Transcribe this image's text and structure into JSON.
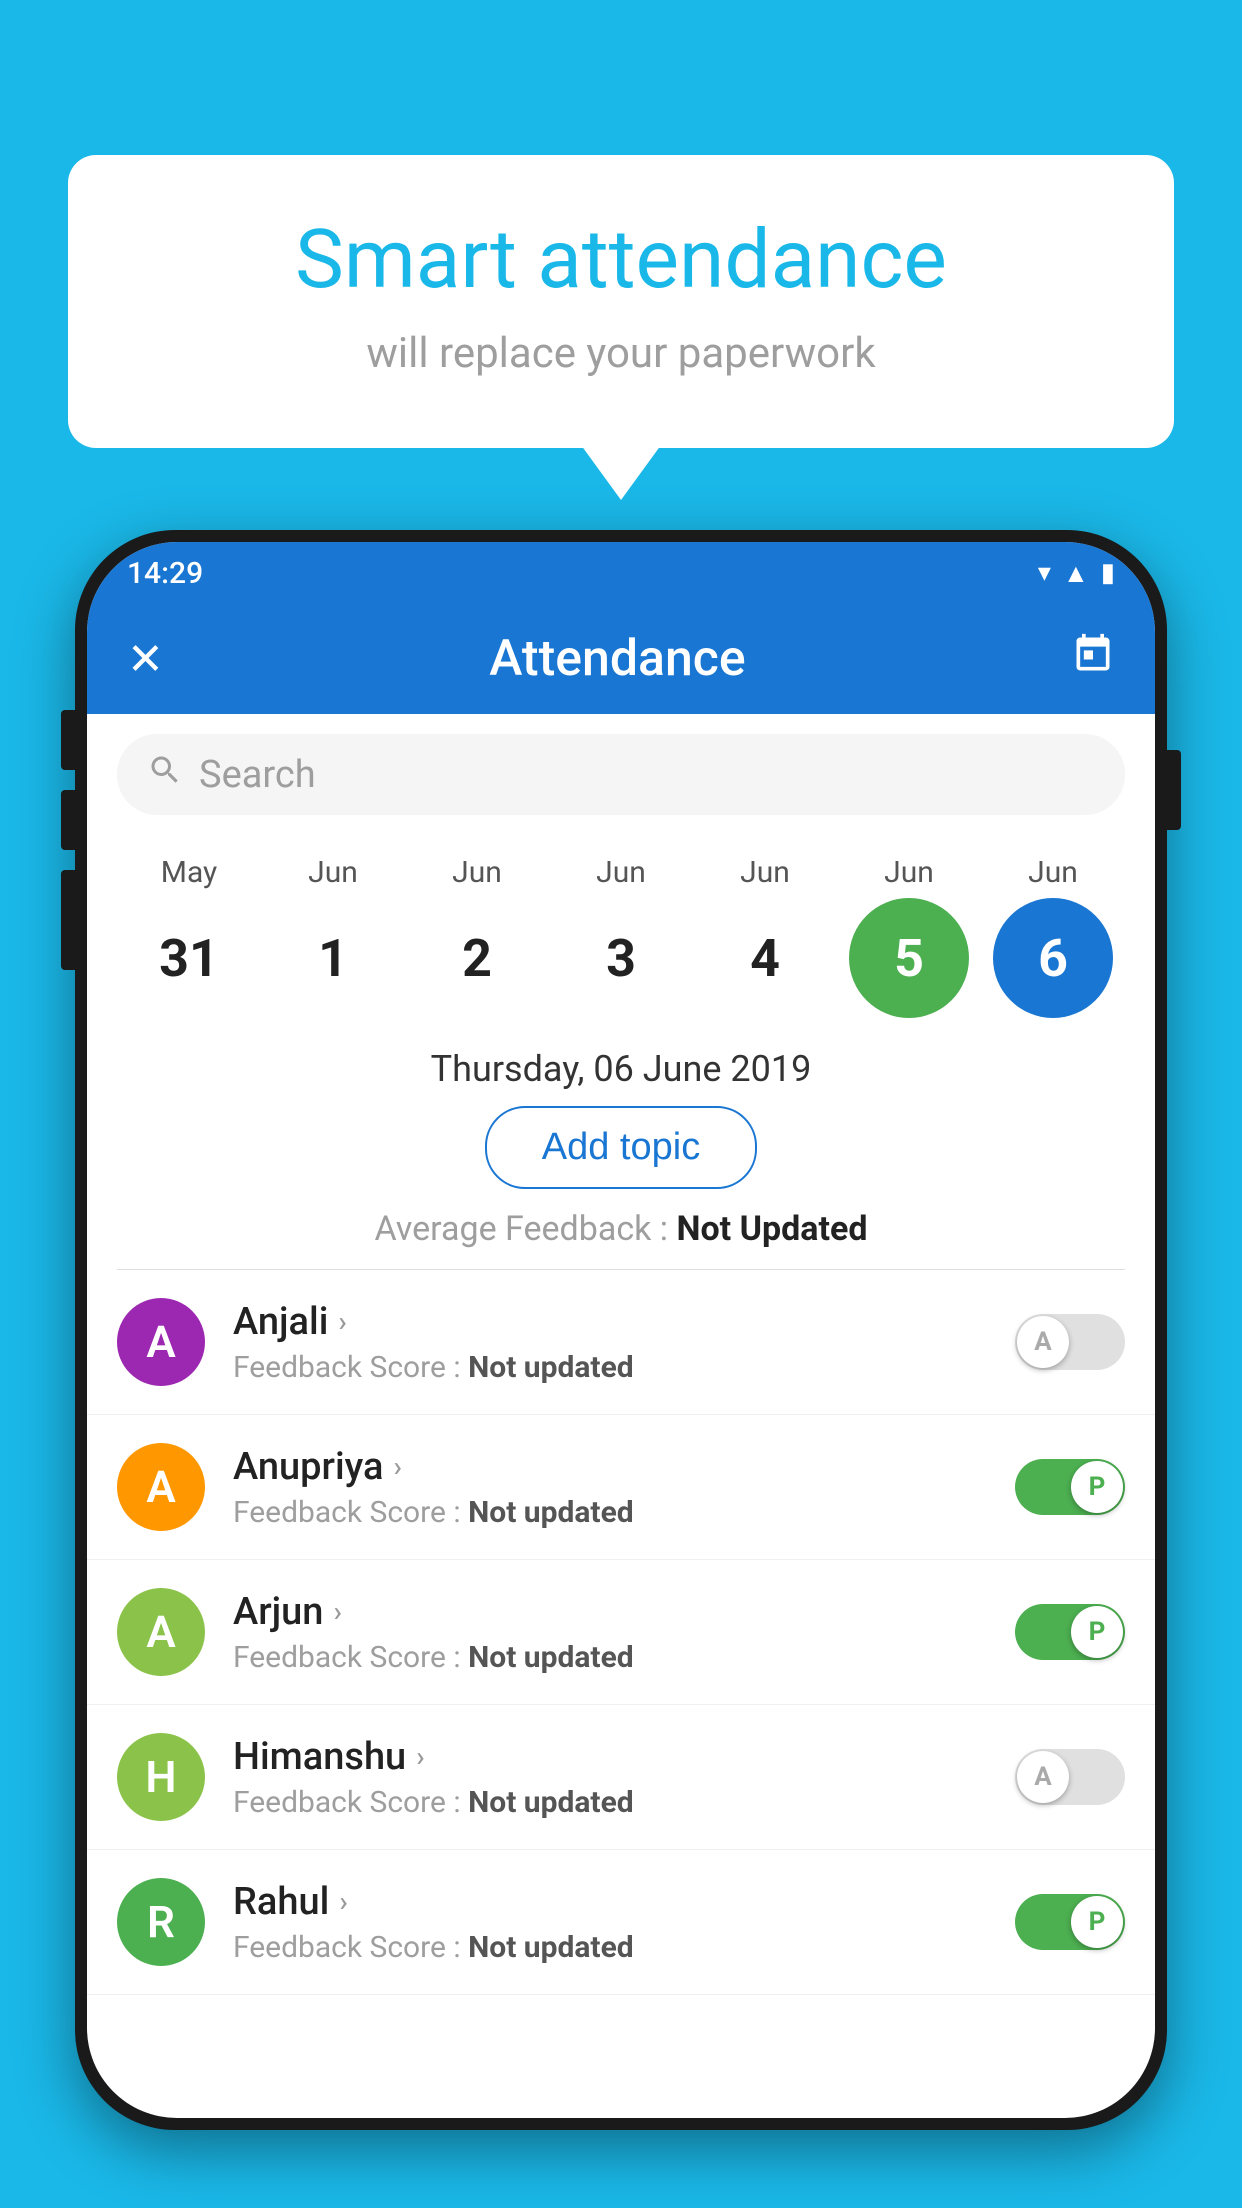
{
  "background_color": "#1ab8e8",
  "speech_bubble": {
    "title": "Smart attendance",
    "subtitle": "will replace your paperwork"
  },
  "status_bar": {
    "time": "14:29",
    "icons": [
      "wifi",
      "signal",
      "battery"
    ]
  },
  "app_bar": {
    "title": "Attendance",
    "close_icon": "✕",
    "calendar_icon": "📅"
  },
  "search": {
    "placeholder": "Search"
  },
  "calendar": {
    "months": [
      "May",
      "Jun",
      "Jun",
      "Jun",
      "Jun",
      "Jun",
      "Jun"
    ],
    "dates": [
      "31",
      "1",
      "2",
      "3",
      "4",
      "5",
      "6"
    ],
    "today_index": 5,
    "selected_index": 6
  },
  "selected_date": "Thursday, 06 June 2019",
  "add_topic_label": "Add topic",
  "avg_feedback": {
    "label": "Average Feedback : ",
    "value": "Not Updated"
  },
  "students": [
    {
      "name": "Anjali",
      "avatar_letter": "A",
      "avatar_color": "#9c27b0",
      "feedback": "Feedback Score : ",
      "feedback_value": "Not updated",
      "toggle_state": "off",
      "toggle_letter": "A"
    },
    {
      "name": "Anupriya",
      "avatar_letter": "A",
      "avatar_color": "#ff9800",
      "feedback": "Feedback Score : ",
      "feedback_value": "Not updated",
      "toggle_state": "on",
      "toggle_letter": "P"
    },
    {
      "name": "Arjun",
      "avatar_letter": "A",
      "avatar_color": "#8bc34a",
      "feedback": "Feedback Score : ",
      "feedback_value": "Not updated",
      "toggle_state": "on",
      "toggle_letter": "P"
    },
    {
      "name": "Himanshu",
      "avatar_letter": "H",
      "avatar_color": "#8bc34a",
      "feedback": "Feedback Score : ",
      "feedback_value": "Not updated",
      "toggle_state": "off",
      "toggle_letter": "A"
    },
    {
      "name": "Rahul",
      "avatar_letter": "R",
      "avatar_color": "#4caf50",
      "feedback": "Feedback Score : ",
      "feedback_value": "Not updated",
      "toggle_state": "on",
      "toggle_letter": "P"
    }
  ]
}
